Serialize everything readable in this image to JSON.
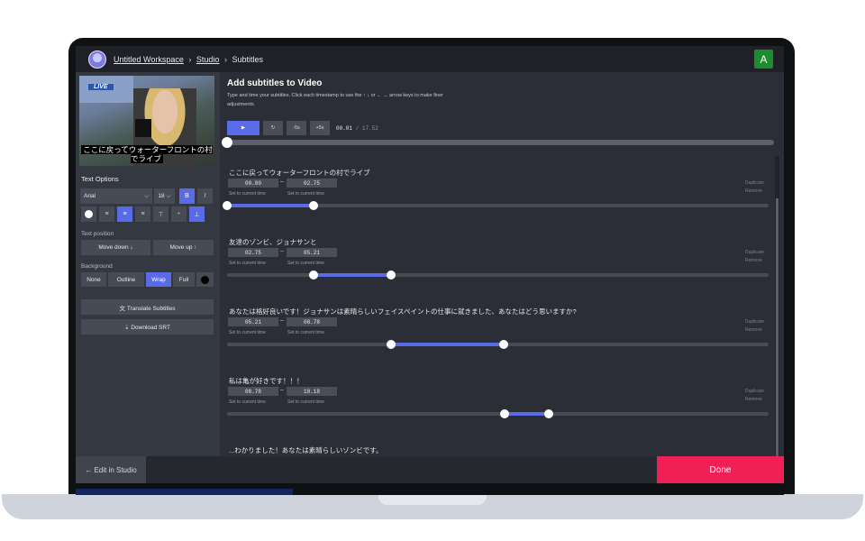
{
  "topbar": {
    "workspace": "Untitled Workspace",
    "studio": "Studio",
    "current": "Subtitles",
    "separator": "›",
    "avatar_letter": "A"
  },
  "sidebar": {
    "video": {
      "live_badge": "LIVE",
      "caption": "ここに戻ってウォーターフロントの村でライブ"
    },
    "text_options_title": "Text Options",
    "font": "Arial",
    "font_size": "18",
    "bold_label": "B",
    "italic_label": "I",
    "text_position_label": "Text position",
    "move_down": "Move down ↓",
    "move_up": "Move up ↑",
    "background_label": "Background",
    "background_options": [
      "None",
      "Outline",
      "Wrap",
      "Full"
    ],
    "background_selected": "Wrap",
    "translate": "文 Translate Subtitles",
    "download": "⇣ Download SRT",
    "edit_in_studio": "← Edit in Studio"
  },
  "main": {
    "title": "Add subtitles to Video",
    "description": "Type and time your subtitles. Click each timestamp to use the ↑ ↓ or ← → arrow keys to make finer adjustments.",
    "controls": {
      "play": "▶",
      "restart": "↻",
      "back": "-5s",
      "forward": "+5s",
      "current_time": "00.01",
      "total_time": "17.52",
      "time_separator": "/"
    },
    "labels": {
      "set_current": "Set to current time",
      "duplicate": "Duplicate",
      "remove": "Remove",
      "dash": "–"
    },
    "subtitles": [
      {
        "text": "ここに戻ってウォーターフロントの村でライブ",
        "start": "00.00",
        "end": "02.75"
      },
      {
        "text": "友達のゾンビ、ジョナサンと",
        "start": "02.75",
        "end": "05.21"
      },
      {
        "text": "あなたは格好良いです！ジョナサンは素晴らしいフェイスペイントの仕事に就きました、あなたはどう思いますか?",
        "start": "05.21",
        "end": "08.78"
      },
      {
        "text": "私は亀が好きです！！！",
        "start": "08.78",
        "end": "10.18"
      },
      {
        "text": "...わかりました！あなたは素晴らしいゾンビです。",
        "start": "",
        "end": ""
      }
    ],
    "done": "Done"
  },
  "colors": {
    "accent": "#5a6be8",
    "done": "#f01f55",
    "avatar": "#1e8b2e"
  }
}
